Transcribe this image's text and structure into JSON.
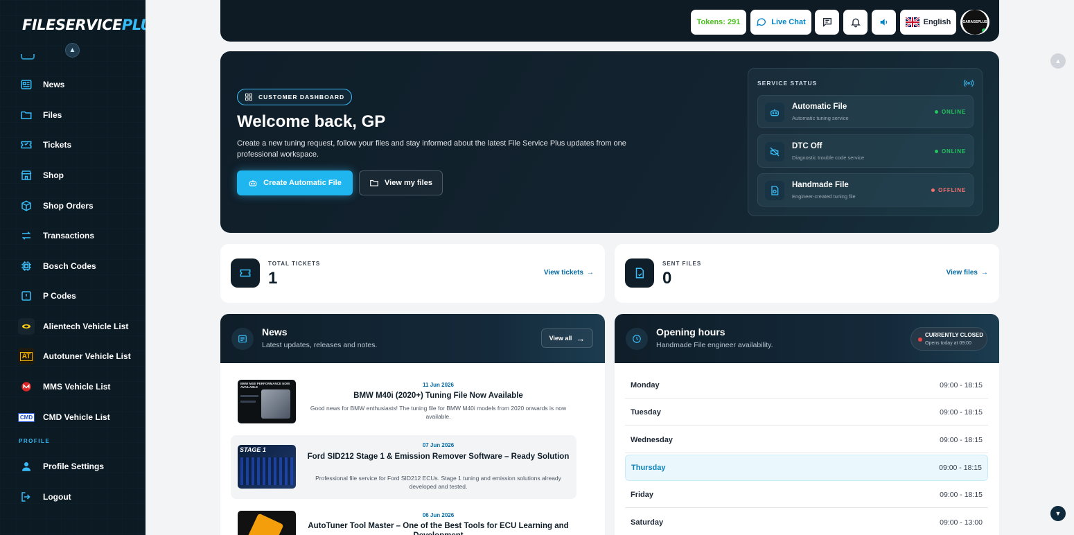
{
  "brand": {
    "part1": "FILESERVICE",
    "part2": "PLUS"
  },
  "sidebar": {
    "items": [
      {
        "label": "News",
        "icon": "newspaper-icon"
      },
      {
        "label": "Files",
        "icon": "folder-icon"
      },
      {
        "label": "Tickets",
        "icon": "ticket-icon"
      },
      {
        "label": "Shop",
        "icon": "store-icon"
      },
      {
        "label": "Shop Orders",
        "icon": "package-icon"
      },
      {
        "label": "Transactions",
        "icon": "arrows-exchange-icon"
      },
      {
        "label": "Bosch Codes",
        "icon": "chip-icon"
      },
      {
        "label": "P Codes",
        "icon": "alert-square-icon"
      },
      {
        "label": "Alientech Vehicle List",
        "icon": "alientech-logo-icon"
      },
      {
        "label": "Autotuner Vehicle List",
        "icon": "autotuner-logo-icon"
      },
      {
        "label": "MMS Vehicle List",
        "icon": "mms-logo-icon"
      },
      {
        "label": "CMD Vehicle List",
        "icon": "cmd-logo-icon"
      }
    ],
    "profile_label": "PROFILE",
    "profile_items": [
      {
        "label": "Profile Settings",
        "icon": "user-icon"
      },
      {
        "label": "Logout",
        "icon": "logout-icon"
      }
    ],
    "cmd_logo_text": "CMD",
    "autotuner_logo_text": "AT"
  },
  "topbar": {
    "tokens": "Tokens: 291",
    "live_chat": "Live Chat",
    "language": "English",
    "avatar_text": "GARAGEPLUS",
    "colors": {
      "tokens": "#4cc21f",
      "chat": "#0284c7"
    }
  },
  "hero": {
    "badge": "CUSTOMER DASHBOARD",
    "welcome": "Welcome back, GP",
    "subtitle": "Create a new tuning request, follow your files and stay informed about the latest File Service Plus updates from one professional workspace.",
    "primary_button": "Create Automatic File",
    "secondary_button": "View my files"
  },
  "service_status": {
    "title": "SERVICE STATUS",
    "items": [
      {
        "name": "Automatic File",
        "desc": "Automatic tuning service",
        "status": "ONLINE",
        "color": "#22c55e"
      },
      {
        "name": "DTC Off",
        "desc": "Diagnostic trouble code service",
        "status": "ONLINE",
        "color": "#22c55e"
      },
      {
        "name": "Handmade File",
        "desc": "Engineer-created tuning file",
        "status": "OFFLINE",
        "color": "#f87171"
      }
    ]
  },
  "stats": {
    "tickets": {
      "label": "TOTAL TICKETS",
      "value": "1",
      "link": "View tickets"
    },
    "files": {
      "label": "SENT FILES",
      "value": "0",
      "link": "View files"
    }
  },
  "news": {
    "title": "News",
    "subtitle": "Latest updates, releases and notes.",
    "view_all": "View all",
    "items": [
      {
        "date": "11 Jun 2026",
        "title": "BMW M40i (2020+) Tuning File Now Available",
        "desc": "Good news for BMW enthusiasts! The tuning file for BMW M40i models from 2020 onwards is now available.",
        "thumb_text": "BMW M40i PERFORMANCE NOW AVAILABLE"
      },
      {
        "date": "07 Jun 2026",
        "title": "Ford SID212 Stage 1 & Emission Remover Software – Ready Solution",
        "desc": "Professional file service for Ford SID212 ECUs. Stage 1 tuning and emission solutions already developed and tested.",
        "thumb_text": "STAGE 1"
      },
      {
        "date": "06 Jun 2026",
        "title": "AutoTuner Tool Master – One of the Best Tools for ECU Learning and Development",
        "desc": ""
      }
    ]
  },
  "hours": {
    "title": "Opening hours",
    "subtitle": "Handmade File engineer availability.",
    "status": "CURRENTLY CLOSED",
    "status_sub": "Opens today at 09:00",
    "rows": [
      {
        "day": "Monday",
        "time": "09:00 - 18:15"
      },
      {
        "day": "Tuesday",
        "time": "09:00 - 18:15"
      },
      {
        "day": "Wednesday",
        "time": "09:00 - 18:15"
      },
      {
        "day": "Thursday",
        "time": "09:00 - 18:15"
      },
      {
        "day": "Friday",
        "time": "09:00 - 18:15"
      },
      {
        "day": "Saturday",
        "time": "09:00 - 13:00"
      }
    ]
  }
}
